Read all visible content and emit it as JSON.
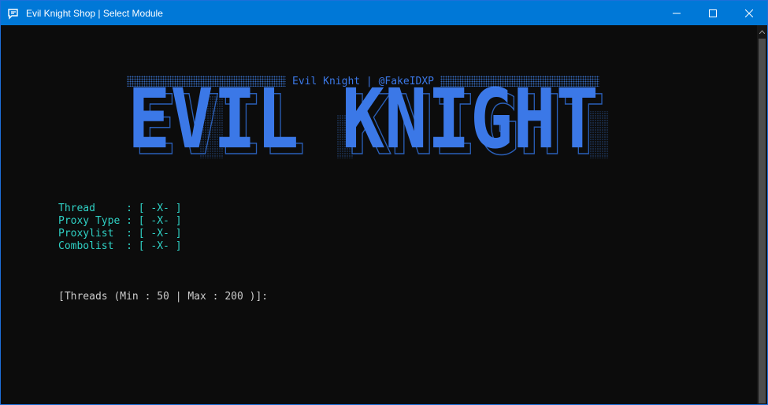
{
  "window": {
    "title": "Evil Knight Shop | Select Module",
    "accent": "#0078d7"
  },
  "console": {
    "header": "Evil Knight | @FakeIDXP",
    "banner_text": "EVIL KNIGHT",
    "banner_color": "#3b78e7",
    "info": [
      {
        "label": "Thread     ",
        "value": ": [ -X- ]"
      },
      {
        "label": "Proxy Type ",
        "value": ": [ -X- ]"
      },
      {
        "label": "Proxylist  ",
        "value": ": [ -X- ]"
      },
      {
        "label": "Combolist  ",
        "value": ": [ -X- ]"
      }
    ],
    "prompt": "[Threads (Min : 50 | Max : 200 )]:",
    "info_color": "#2fd1c5"
  }
}
